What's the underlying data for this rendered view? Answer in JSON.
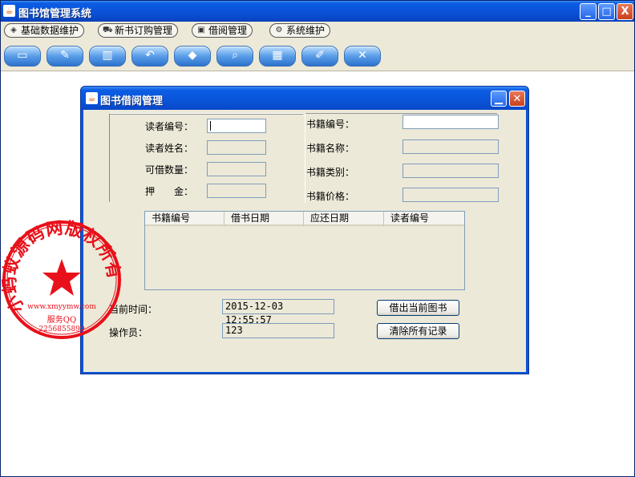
{
  "app": {
    "title": "图书馆管理系统",
    "window_controls": {
      "minimize": "_",
      "maximize": "□",
      "close": "X"
    }
  },
  "menubar": {
    "items": [
      {
        "label": "基础数据维护",
        "icon": "cube-icon"
      },
      {
        "label": "新书订购管理",
        "icon": "cart-icon"
      },
      {
        "label": "借阅管理",
        "icon": "lock-icon"
      },
      {
        "label": "系统维护",
        "icon": "gears-icon"
      }
    ]
  },
  "toolbar": {
    "buttons": [
      {
        "icon": "book-icon"
      },
      {
        "icon": "pencil-icon"
      },
      {
        "icon": "books-icon"
      },
      {
        "icon": "return-icon"
      },
      {
        "icon": "box-icon"
      },
      {
        "icon": "magnifier-icon"
      },
      {
        "icon": "chart-icon"
      },
      {
        "icon": "document-edit-icon"
      },
      {
        "icon": "tools-exit-icon"
      }
    ]
  },
  "borrow_frame": {
    "title": "图书借阅管理",
    "reader": {
      "id_label": "读者编号：",
      "id_value": "",
      "name_label": "读者姓名：",
      "name_value": "",
      "quota_label": "可借数量：",
      "quota_value": "",
      "deposit_label": "押　　金：",
      "deposit_value": ""
    },
    "book": {
      "id_label": "书籍编号：",
      "id_value": "",
      "name_label": "书籍名称：",
      "name_value": "",
      "type_label": "书籍类别：",
      "type_value": "",
      "price_label": "书籍价格：",
      "price_value": ""
    },
    "table": {
      "columns": [
        "书籍编号",
        "借书日期",
        "应还日期",
        "读者编号"
      ],
      "rows": []
    },
    "current_time_label": "当前时间：",
    "current_time_value": "2015-12-03 12:55:57",
    "operator_label": "操作员：",
    "operator_value": "123",
    "borrow_button": "借出当前图书",
    "clear_button": "清除所有记录"
  },
  "stamp": {
    "text": "小蚂蚁源码网版权所有",
    "url": "www.xmyymw.com",
    "service": "服务QQ",
    "qq": "2256855899",
    "color": "#e8101a"
  }
}
